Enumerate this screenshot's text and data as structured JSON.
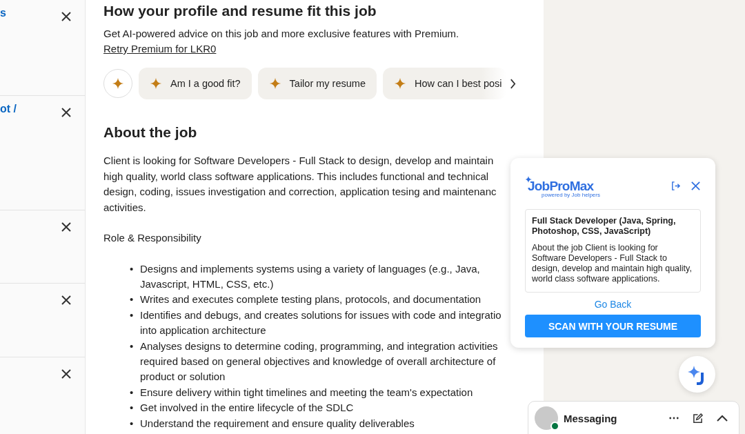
{
  "job_list": [
    {
      "title": "s",
      "dismissible": true
    },
    {
      "title": "ot /",
      "dismissible": true
    },
    {
      "dismissible": true
    },
    {
      "dismissible": true
    },
    {
      "dismissible": true
    }
  ],
  "fit": {
    "heading": "How your profile and resume fit this job",
    "text": "Get AI-powered advice on this job and more exclusive features with Premium. ",
    "link": "Retry Premium for LKR0",
    "chips": [
      "Am I a good fit?",
      "Tailor my resume",
      "How can I best posi"
    ]
  },
  "about": {
    "heading": "About the job",
    "intro_lines": [
      "Client is looking for Software Developers - Full Stack to design, develop and maintain",
      "high quality, world class software applications. This includes functional and technical",
      "design, coding, issues investigation and correction, application tesing and maintenanc",
      "activities."
    ],
    "section": "Role & Responsibility",
    "bullet_marker": "•",
    "bullets": [
      {
        "lines": [
          "Designs and implements systems using a variety of languages (e.g., Java,",
          "Javascript, HTML, CSS, etc.)"
        ]
      },
      {
        "lines": [
          "Writes and executes complete testing plans, protocols, and documentation"
        ]
      },
      {
        "lines": [
          "Identifies and debugs, and creates solutions for issues with code and integratio",
          "into application architecture"
        ]
      },
      {
        "lines": [
          "Analyses designs to determine coding, programming, and integration activities",
          "required based on general objectives and knowledge of overall architecture of",
          "product or solution"
        ]
      },
      {
        "lines": [
          "Ensure delivery within tight timelines and meeting the team's expectation"
        ]
      },
      {
        "lines": [
          "Get involved in the entire lifecycle of the SDLC"
        ]
      },
      {
        "lines": [
          "Understand the requirement and ensure quality deliverables"
        ]
      }
    ]
  },
  "extension": {
    "logo": "JobProMax",
    "logo_sub": "powered by Job helpers",
    "job_title": "Full Stack Developer (Java, Spring, Photoshop, CSS, JavaScript)",
    "job_excerpt": "About the job Client is looking for Software Developers - Full Stack to design, develop and maintain high quality, world class software applications.",
    "go_back": "Go Back",
    "scan_button": "SCAN WITH YOUR RESUME"
  },
  "messaging": {
    "label": "Messaging",
    "online": true
  }
}
